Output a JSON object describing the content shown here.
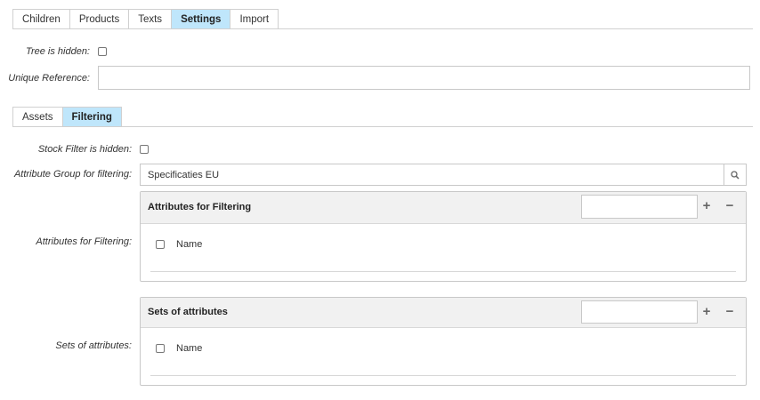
{
  "tabs": {
    "items": [
      {
        "label": "Children"
      },
      {
        "label": "Products"
      },
      {
        "label": "Texts"
      },
      {
        "label": "Settings"
      },
      {
        "label": "Import"
      }
    ],
    "active": "Settings"
  },
  "settings": {
    "tree_hidden_label": "Tree is hidden:",
    "tree_hidden_checked": false,
    "unique_reference_label": "Unique Reference:",
    "unique_reference_value": ""
  },
  "subtabs": {
    "items": [
      {
        "label": "Assets"
      },
      {
        "label": "Filtering"
      }
    ],
    "active": "Filtering"
  },
  "filtering": {
    "stock_filter_hidden_label": "Stock Filter is hidden:",
    "stock_filter_hidden_checked": false,
    "attribute_group_label": "Attribute Group for filtering:",
    "attribute_group_value": "Specificaties EU",
    "attributes_for_filtering_label": "Attributes for Filtering:",
    "attributes_panel": {
      "title": "Attributes for Filtering",
      "search_value": "",
      "add_symbol": "+",
      "remove_symbol": "−",
      "column_name": "Name"
    },
    "sets_label": "Sets of attributes:",
    "sets_panel": {
      "title": "Sets of attributes",
      "search_value": "",
      "add_symbol": "+",
      "remove_symbol": "−",
      "column_name": "Name"
    }
  },
  "colors": {
    "active_tab": "#bfe6fb",
    "panel_header": "#f1f1f1",
    "border": "#c8c8c8"
  }
}
